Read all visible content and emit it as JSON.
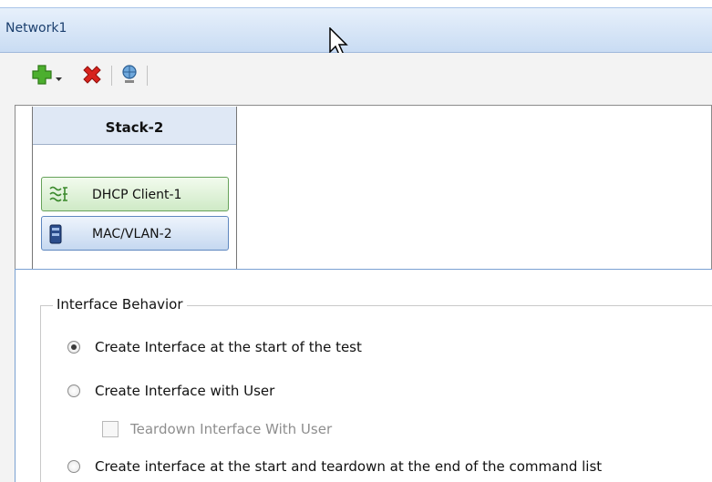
{
  "window": {
    "title": "Network1"
  },
  "toolbar": {
    "add_icon": "green-plus-icon",
    "dropdown_icon": "dropdown-arrow-icon",
    "delete_icon": "red-x-icon",
    "network_icon": "globe-person-icon"
  },
  "stack": {
    "title": "Stack-2",
    "layers": [
      {
        "label": "DHCP Client-1",
        "icon": "dhcp-waves-icon",
        "color": "#cfeac6"
      },
      {
        "label": "MAC/VLAN-2",
        "icon": "mac-vlan-icon",
        "color": "#c5d8f0"
      }
    ]
  },
  "interface_behavior": {
    "legend": "Interface Behavior",
    "options": [
      {
        "label": "Create Interface at the start of the test",
        "selected": true
      },
      {
        "label": "Create Interface with User",
        "selected": false
      },
      {
        "label": "Create interface at the start and teardown at the end of the command list",
        "selected": false
      }
    ],
    "teardown_checkbox": {
      "label": "Teardown Interface With User",
      "checked": false,
      "enabled": false
    }
  }
}
